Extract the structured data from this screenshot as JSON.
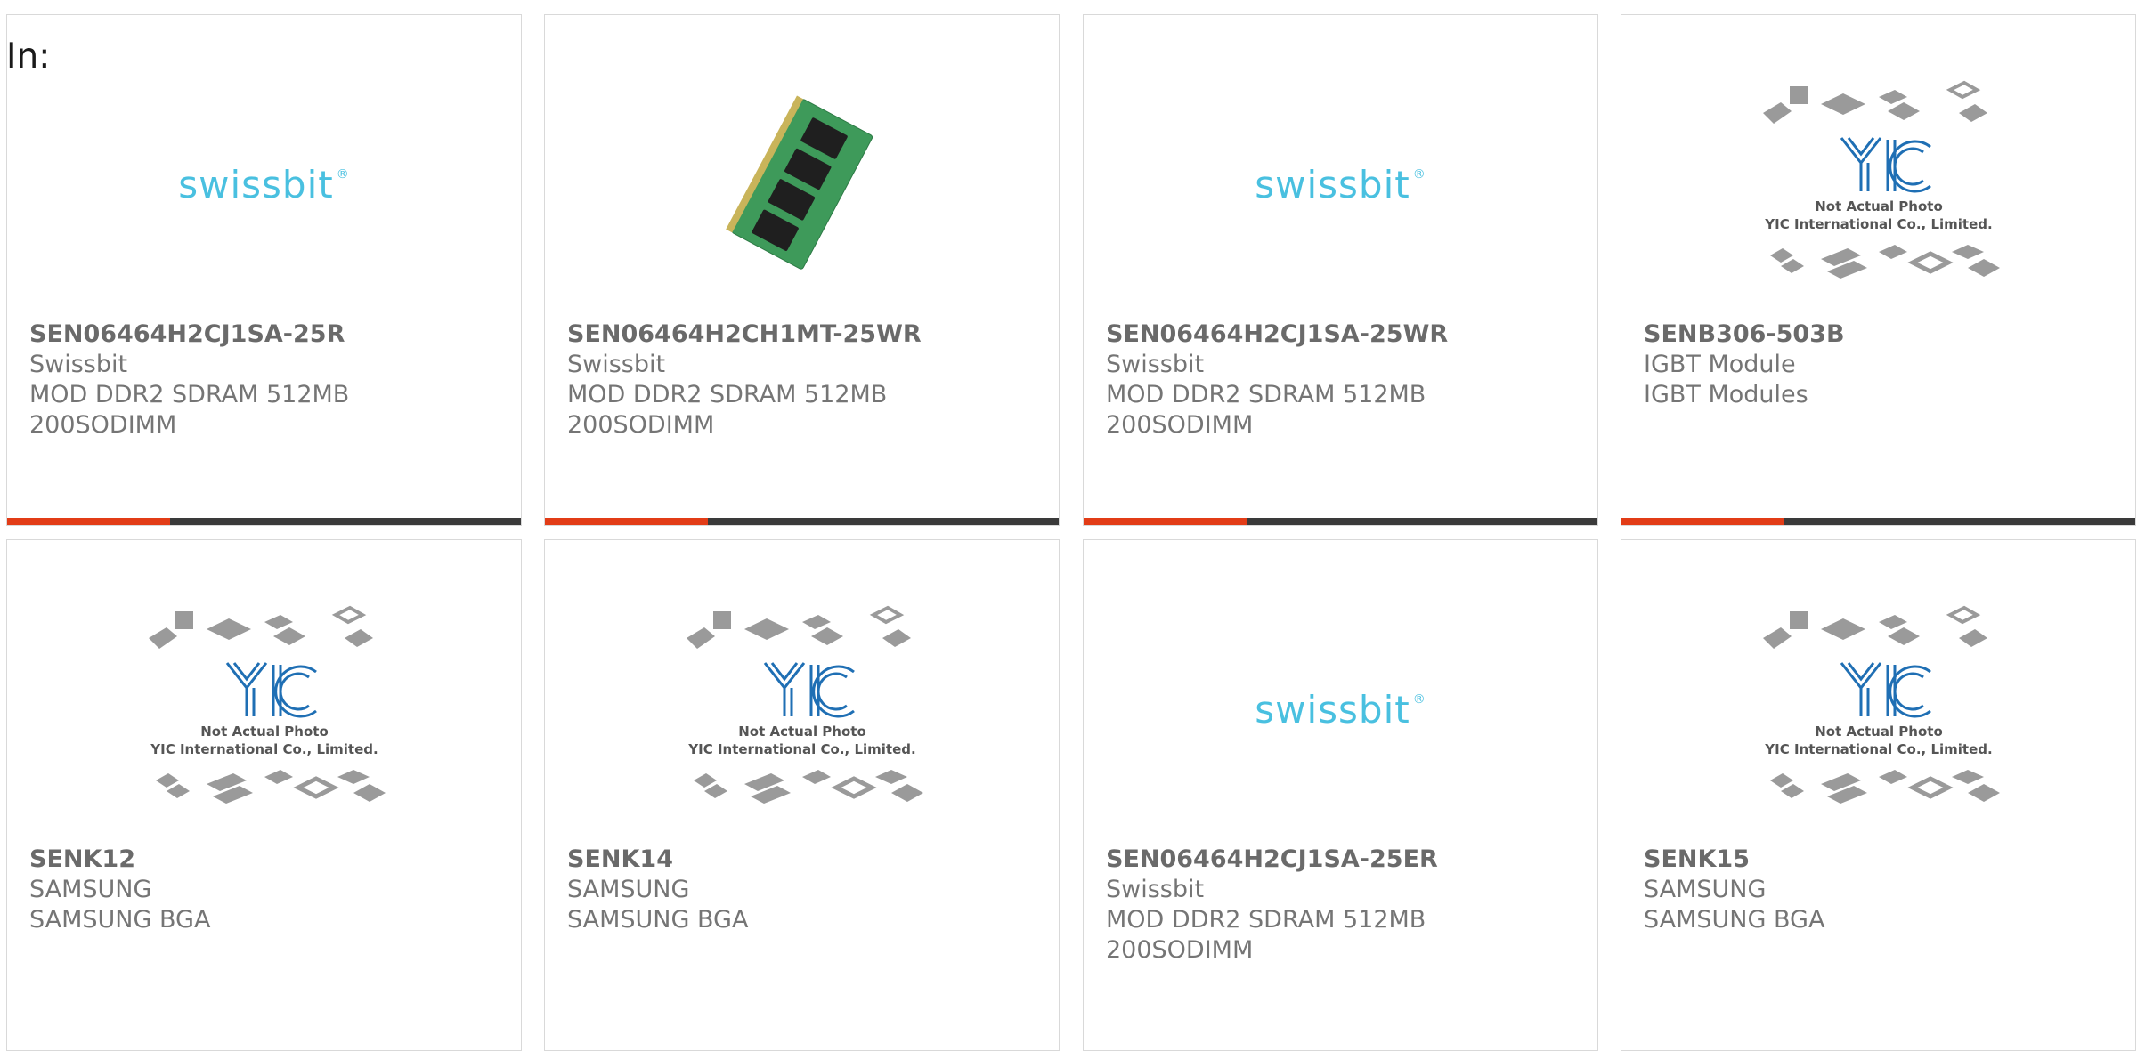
{
  "header": {
    "in_label": "In:"
  },
  "cards": [
    {
      "part": "SEN06464H2CJ1SA-25R",
      "maker": "Swissbit",
      "desc1": "MOD DDR2 SDRAM 512MB",
      "desc2": "200SODIMM",
      "image": "swissbit-logo",
      "logo_text": "swissbit",
      "logo_mark": "®"
    },
    {
      "part": "SEN06464H2CH1MT-25WR",
      "maker": "Swissbit",
      "desc1": "MOD DDR2 SDRAM 512MB",
      "desc2": "200SODIMM",
      "image": "memory-module-photo"
    },
    {
      "part": "SEN06464H2CJ1SA-25WR",
      "maker": "Swissbit",
      "desc1": "MOD DDR2 SDRAM 512MB",
      "desc2": "200SODIMM",
      "image": "swissbit-logo",
      "logo_text": "swissbit",
      "logo_mark": "®"
    },
    {
      "part": "SENB306-503B",
      "maker": "IGBT Module",
      "desc1": "IGBT Modules",
      "desc2": "",
      "image": "yic-placeholder",
      "ph_line1": "Not Actual Photo",
      "ph_line2": "YIC International Co., Limited."
    },
    {
      "part": "SENK12",
      "maker": "SAMSUNG",
      "desc1": "SAMSUNG BGA",
      "desc2": "",
      "image": "yic-placeholder",
      "ph_line1": "Not Actual Photo",
      "ph_line2": "YIC International Co., Limited."
    },
    {
      "part": "SENK14",
      "maker": "SAMSUNG",
      "desc1": "SAMSUNG BGA",
      "desc2": "",
      "image": "yic-placeholder",
      "ph_line1": "Not Actual Photo",
      "ph_line2": "YIC International Co., Limited."
    },
    {
      "part": "SEN06464H2CJ1SA-25ER",
      "maker": "Swissbit",
      "desc1": "MOD DDR2 SDRAM 512MB",
      "desc2": "200SODIMM",
      "image": "swissbit-logo",
      "logo_text": "swissbit",
      "logo_mark": "®"
    },
    {
      "part": "SENK15",
      "maker": "SAMSUNG",
      "desc1": "SAMSUNG BGA",
      "desc2": "",
      "image": "yic-placeholder",
      "ph_line1": "Not Actual Photo",
      "ph_line2": "YIC International Co., Limited."
    }
  ],
  "colors": {
    "accent": "#e23c17",
    "bar": "#3a3a3a",
    "swissbit": "#49c0e0",
    "yic_blue": "#1f6fb4"
  }
}
